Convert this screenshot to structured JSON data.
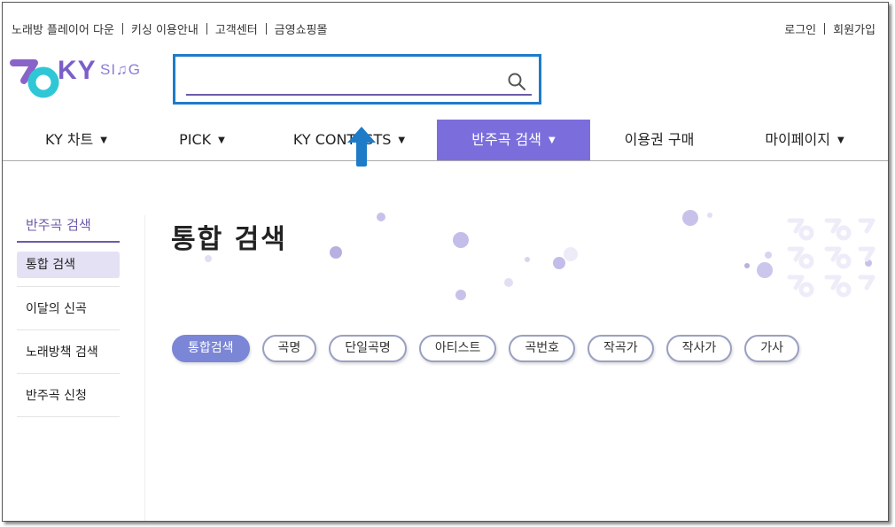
{
  "util_nav": {
    "left": [
      "노래방 플레이어 다운",
      "키싱 이용안내",
      "고객센터",
      "금영쇼핑몰"
    ],
    "right": [
      "로그인",
      "회원가입"
    ]
  },
  "logo": {
    "ky": "KY",
    "sing": "SI♫G"
  },
  "search": {
    "value": "",
    "placeholder": ""
  },
  "main_nav": [
    {
      "label": "KY 차트",
      "caret": "▼"
    },
    {
      "label": "PICK",
      "caret": "▼"
    },
    {
      "label": "KY CONTESTS",
      "caret": "▼"
    },
    {
      "label": "반주곡 검색",
      "caret": "▼",
      "active": true
    },
    {
      "label": "이용권 구매"
    },
    {
      "label": "마이페이지",
      "caret": "▼"
    }
  ],
  "sidebar": {
    "title": "반주곡 검색",
    "items": [
      "통합 검색",
      "이달의 신곡",
      "노래방책 검색",
      "반주곡 신청"
    ]
  },
  "page_title": "통합 검색",
  "filter_tabs": [
    "통합검색",
    "곡명",
    "단일곡명",
    "아티스트",
    "곡번호",
    "작곡가",
    "작사가",
    "가사"
  ],
  "colors": {
    "accent": "#7b6edc",
    "search_border": "#1e7bc8",
    "arrow": "#1e7bc8",
    "chip_active": "#7b86d6"
  },
  "icons": {
    "search": "search-icon",
    "caret": "chevron-down-icon",
    "annotation": "arrow-up-icon"
  }
}
